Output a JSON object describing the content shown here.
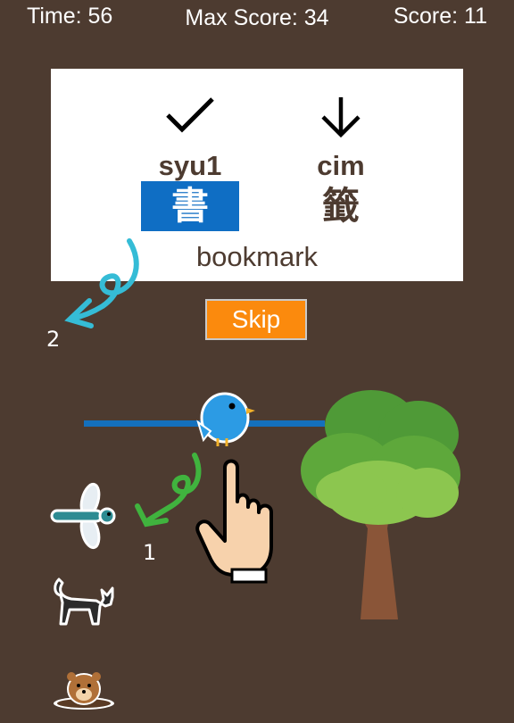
{
  "hud": {
    "time": "Time: 56",
    "max_score": "Max Score: 34",
    "score": "Score: 11"
  },
  "card": {
    "left": {
      "romanization": "syu1",
      "character": "書",
      "mark_icon": "check-icon"
    },
    "right": {
      "romanization": "cim",
      "character": "籤",
      "mark_icon": "down-arrow-icon"
    },
    "meaning": "bookmark"
  },
  "skip_label": "Skip",
  "hints": {
    "first": "1",
    "second": "2"
  },
  "colors": {
    "background": "#4d3b30",
    "selected": "#0f6ec4",
    "skip": "#fb8a0d",
    "wire": "#1470bd"
  },
  "icons": [
    "check-icon",
    "down-arrow-icon",
    "swipe-arrow-1-icon",
    "swipe-arrow-2-icon",
    "bird-icon",
    "hand-pointer-icon",
    "tree-icon",
    "dragonfly-icon",
    "cat-icon",
    "beaver-icon"
  ]
}
